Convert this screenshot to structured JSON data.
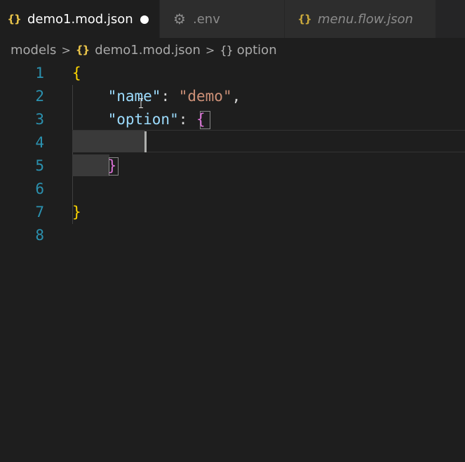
{
  "tabs": [
    {
      "label": "demo1.mod.json",
      "icon": "json-braces-icon",
      "icon_glyph": "{}",
      "active": true,
      "dirty": true,
      "italic": false
    },
    {
      "label": ".env",
      "icon": "gear-icon",
      "icon_glyph": "⚙",
      "active": false,
      "dirty": false,
      "italic": false
    },
    {
      "label": "menu.flow.json",
      "icon": "json-braces-icon",
      "icon_glyph": "{}",
      "active": false,
      "dirty": false,
      "italic": true
    }
  ],
  "breadcrumb": {
    "folder": "models",
    "file": "demo1.mod.json",
    "file_icon": "{}",
    "symbol_icon": "{}",
    "symbol": "option",
    "separator": ">"
  },
  "editor": {
    "line_numbers": [
      "1",
      "2",
      "3",
      "4",
      "5",
      "6",
      "7",
      "8"
    ],
    "lines": [
      {
        "text": "{"
      },
      {
        "text": "    \"name\": \"demo\","
      },
      {
        "text": "    \"option\": {"
      },
      {
        "text": ""
      },
      {
        "text": "    }"
      },
      {
        "text": ""
      },
      {
        "text": "}"
      },
      {
        "text": ""
      }
    ],
    "tokens": {
      "l1_open": "{",
      "l2_indent": "    ",
      "l2_key": "\"name\"",
      "l2_colon": ": ",
      "l2_value": "\"demo\"",
      "l2_comma": ",",
      "l3_indent": "    ",
      "l3_key": "\"option\"",
      "l3_colon": ": ",
      "l3_open": "{",
      "l5_indent": "    ",
      "l5_close": "}",
      "l7_close": "}"
    }
  },
  "colors": {
    "background": "#1e1e1e",
    "line_number": "#2b91af",
    "bracket_level_1": "#ffd700",
    "bracket_level_2": "#da70d6",
    "json_key": "#9cdcfe",
    "json_string": "#ce9178",
    "json_file_icon": "#e8c34a"
  }
}
